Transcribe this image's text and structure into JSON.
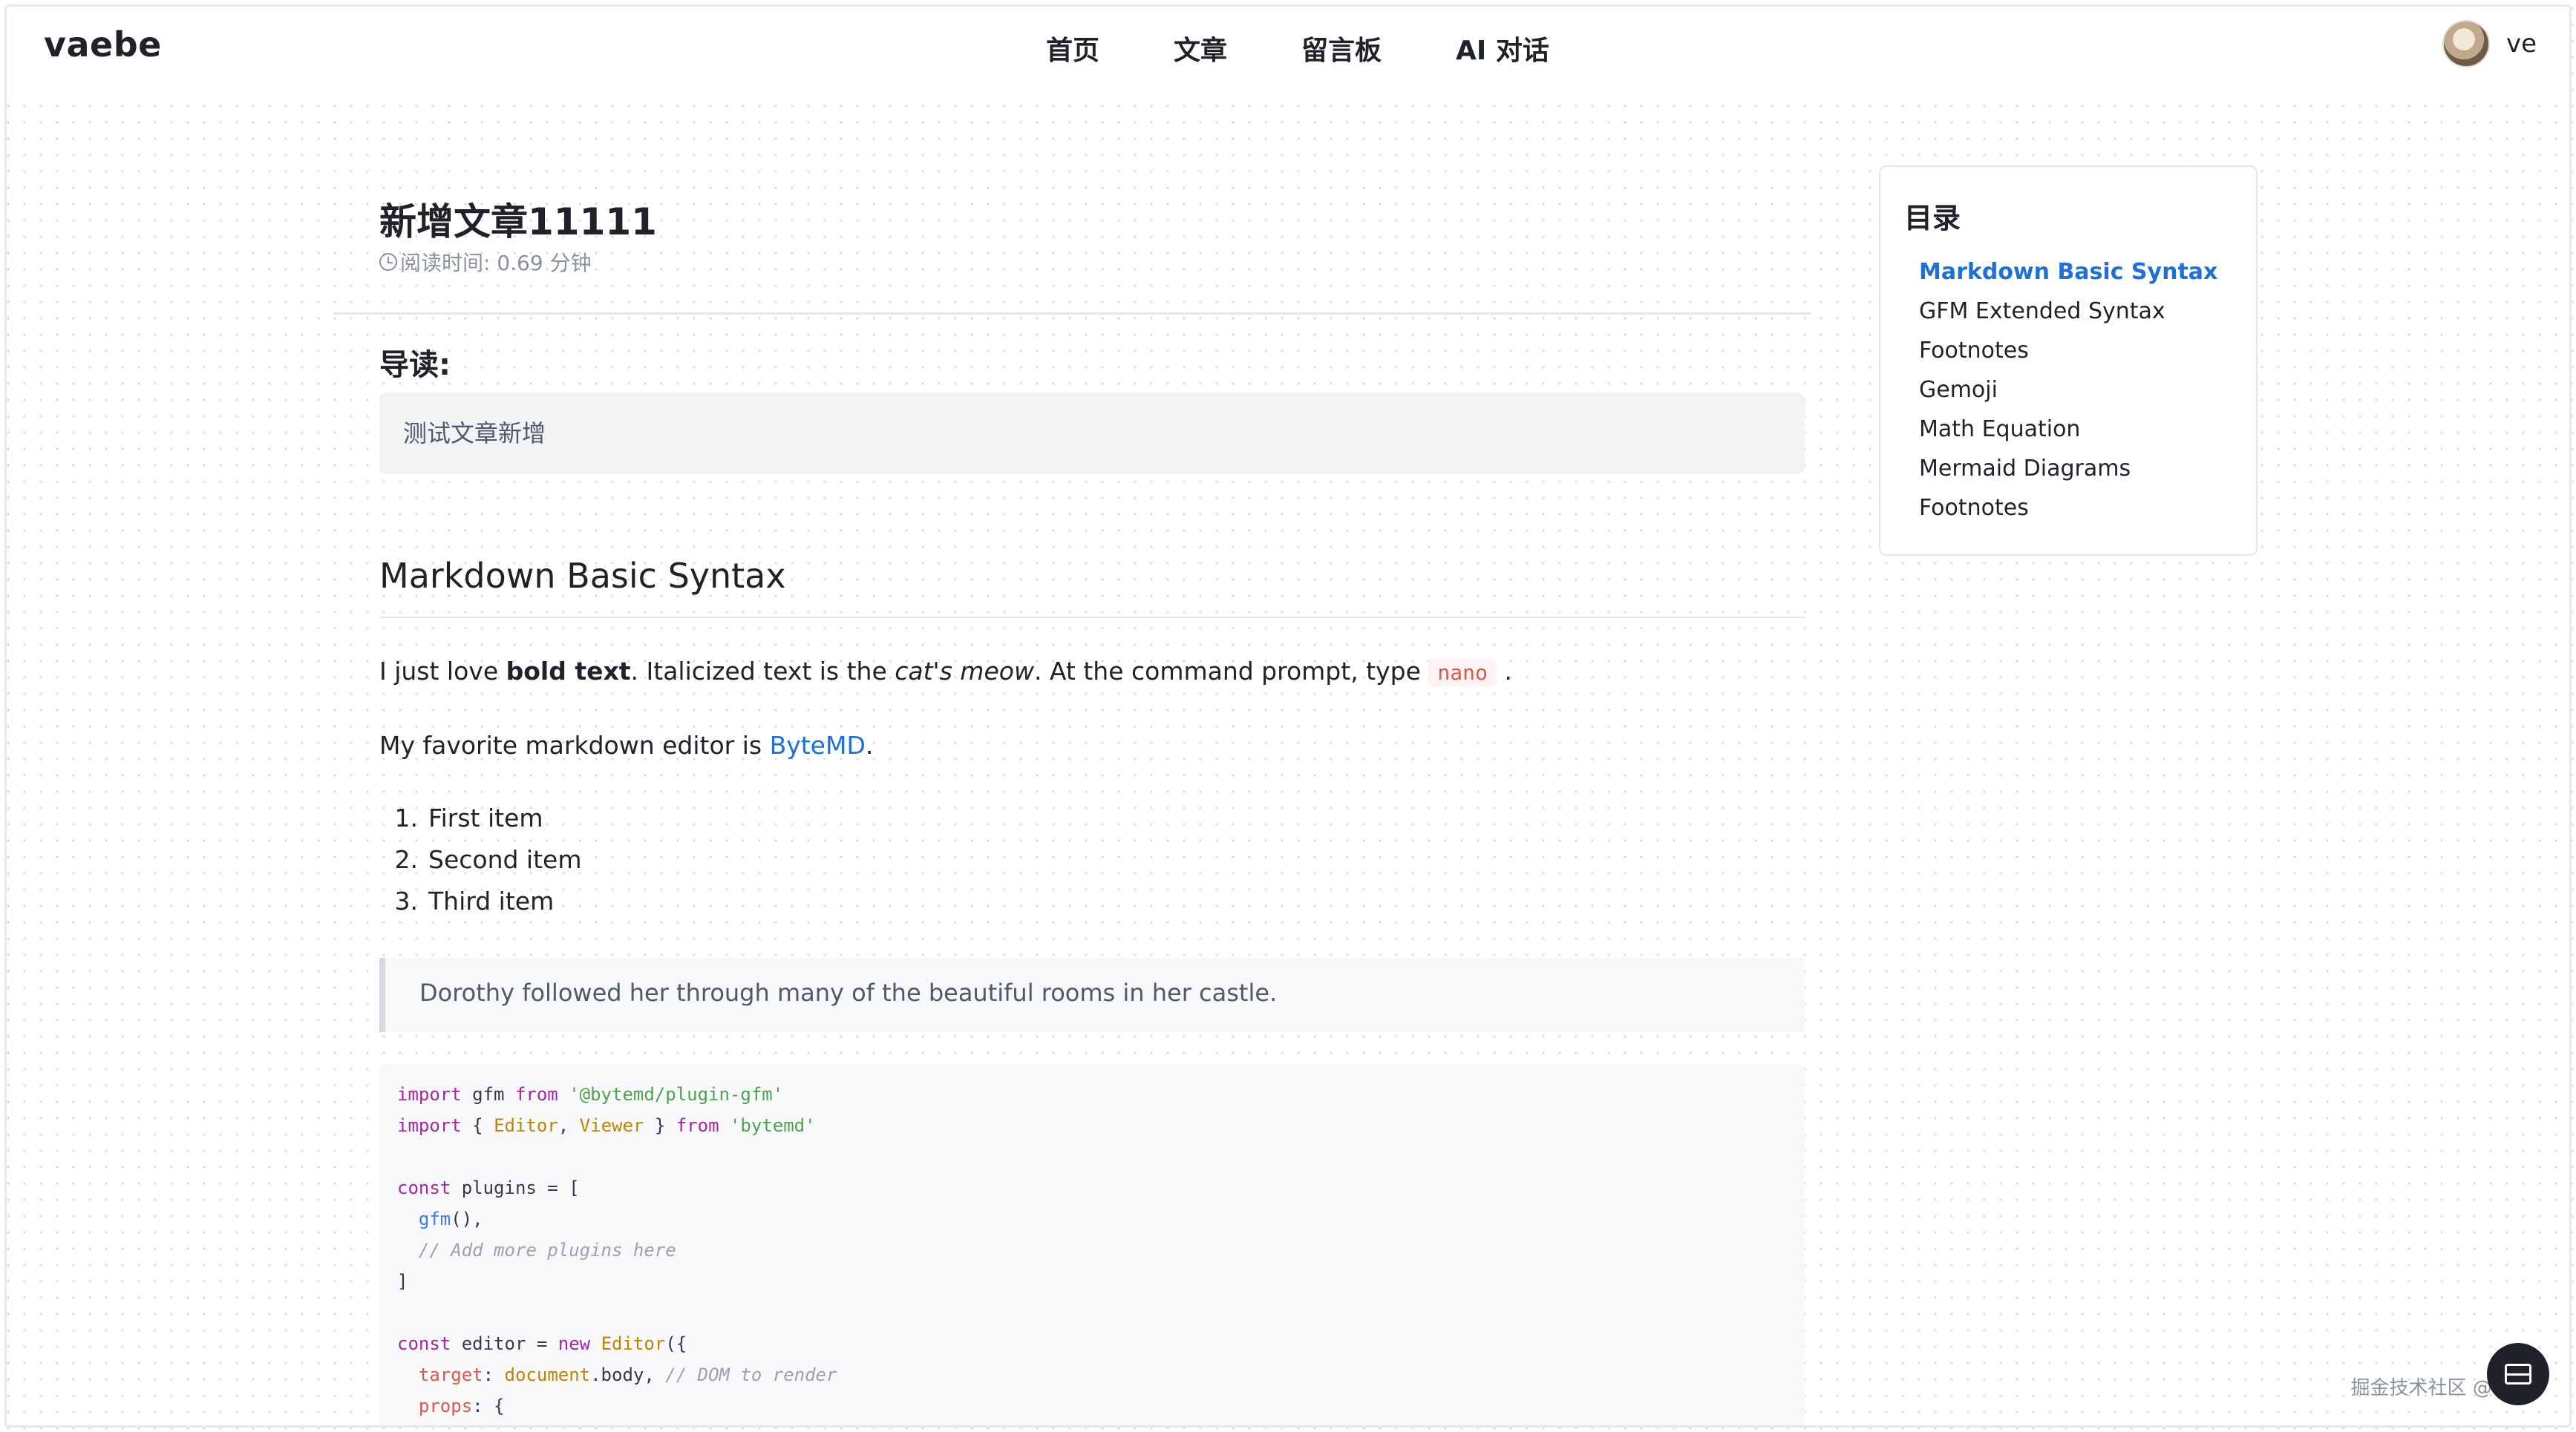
{
  "header": {
    "logo": "vaebe",
    "nav": [
      "首页",
      "文章",
      "留言板",
      "AI 对话"
    ],
    "username": "ve"
  },
  "article": {
    "title": "新增文章11111",
    "reading_time": "阅读时间: 0.69 分钟",
    "intro_label": "导读:",
    "intro_text": "测试文章新增",
    "section_heading": "Markdown Basic Syntax",
    "para1": {
      "t1": "I just love ",
      "bold": "bold text",
      "t2": ". Italicized text is the ",
      "italic": "cat's meow",
      "t3": ". At the command prompt, type ",
      "code": "nano",
      "t4": " ."
    },
    "para2": {
      "t1": "My favorite markdown editor is ",
      "link": "ByteMD",
      "t2": "."
    },
    "ordered_list": [
      {
        "num": "1.",
        "text": "First item"
      },
      {
        "num": "2.",
        "text": "Second item"
      },
      {
        "num": "3.",
        "text": "Third item"
      }
    ],
    "blockquote": "Dorothy followed her through many of the beautiful rooms in her castle.",
    "code": {
      "l1": {
        "k1": "import",
        "t1": " gfm ",
        "k2": "from",
        "t2": " ",
        "s": "'@bytemd/plugin-gfm'"
      },
      "l2": {
        "k1": "import",
        "t1": " { ",
        "c1": "Editor",
        "t2": ", ",
        "c2": "Viewer",
        "t3": " } ",
        "k2": "from",
        "t4": " ",
        "s": "'bytemd'"
      },
      "l4": {
        "k": "const",
        "t": " plugins = ["
      },
      "l5": {
        "f": "gfm",
        "t": "(),"
      },
      "l6": {
        "c": "// Add more plugins here"
      },
      "l7": {
        "t": "]"
      },
      "l9": {
        "k1": "const",
        "t1": " editor = ",
        "k2": "new",
        "t2": " ",
        "c": "Editor",
        "t3": "({"
      },
      "l10": {
        "p": "target",
        "t1": ": ",
        "c": "document",
        "t2": ".body, ",
        "cm": "// DOM to render"
      },
      "l11": {
        "p": "props",
        "t": ": {"
      }
    }
  },
  "toc": {
    "title": "目录",
    "items": [
      "Markdown Basic Syntax",
      "GFM Extended Syntax",
      "Footnotes",
      "Gemoji",
      "Math Equation",
      "Mermaid Diagrams",
      "Footnotes"
    ]
  },
  "watermark": "掘金技术社区 @ 唐诗"
}
